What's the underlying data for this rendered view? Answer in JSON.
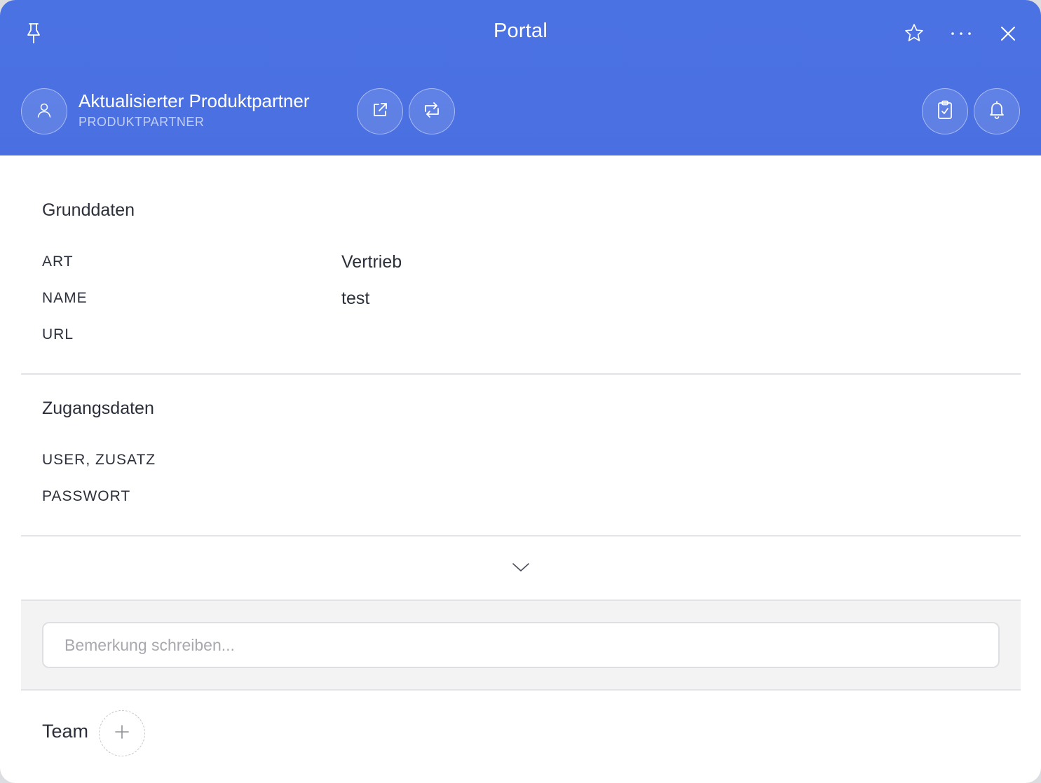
{
  "window": {
    "title": "Portal"
  },
  "entity": {
    "name": "Aktualisierter Produktpartner",
    "type": "PRODUKTPARTNER"
  },
  "icons": {
    "pin": "pin-icon",
    "star": "star-icon",
    "more": "more-icon",
    "close": "close-icon",
    "avatar": "user-icon",
    "open_external": "external-link-icon",
    "sync": "sync-icon",
    "clipboard": "clipboard-check-icon",
    "bell": "bell-icon",
    "expand": "chevron-down-icon",
    "add": "plus-icon"
  },
  "colors": {
    "header": "#4b72e3",
    "text": "#2b2f3a",
    "divider": "#e2e3e6",
    "comment_bg": "#f3f3f4"
  },
  "grunddaten": {
    "title": "Grunddaten",
    "fields": [
      {
        "label": "ART",
        "value": "Vertrieb"
      },
      {
        "label": "NAME",
        "value": "test"
      },
      {
        "label": "URL",
        "value": ""
      }
    ]
  },
  "zugangsdaten": {
    "title": "Zugangsdaten",
    "fields": [
      {
        "label": "USER, ZUSATZ",
        "value": ""
      },
      {
        "label": "PASSWORT",
        "value": ""
      }
    ]
  },
  "comment": {
    "placeholder": "Bemerkung schreiben...",
    "value": ""
  },
  "team": {
    "label": "Team"
  }
}
